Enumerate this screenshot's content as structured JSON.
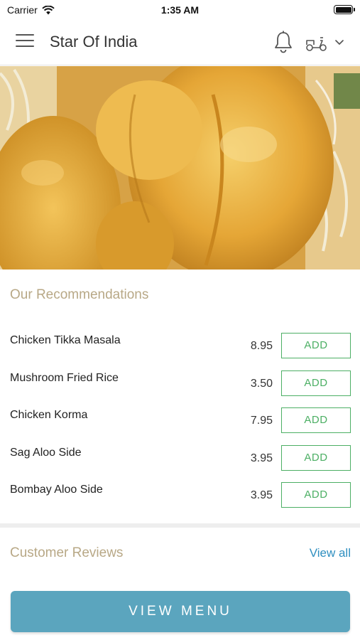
{
  "status_bar": {
    "carrier": "Carrier",
    "time": "1:35 AM"
  },
  "header": {
    "title": "Star Of India",
    "icons": [
      "menu-icon",
      "bell-icon",
      "scooter-icon",
      "chevron-down-icon"
    ]
  },
  "hero": {
    "image": "roast-chicken-biryani-photo"
  },
  "recommendations": {
    "title": "Our Recommendations",
    "add_label": "ADD",
    "items": [
      {
        "name": "Chicken Tikka Masala",
        "price": "8.95"
      },
      {
        "name": "Mushroom Fried Rice",
        "price": "3.50"
      },
      {
        "name": "Chicken Korma",
        "price": "7.95"
      },
      {
        "name": "Sag Aloo Side",
        "price": "3.95"
      },
      {
        "name": "Bombay Aloo Side",
        "price": "3.95"
      }
    ]
  },
  "reviews": {
    "title": "Customer Reviews",
    "view_all": "View all"
  },
  "footer": {
    "view_menu": "VIEW MENU"
  },
  "colors": {
    "accent_green": "#4caf64",
    "section_title": "#b8a886",
    "link_blue": "#2f8fc0",
    "button_blue": "#5ba5be"
  }
}
